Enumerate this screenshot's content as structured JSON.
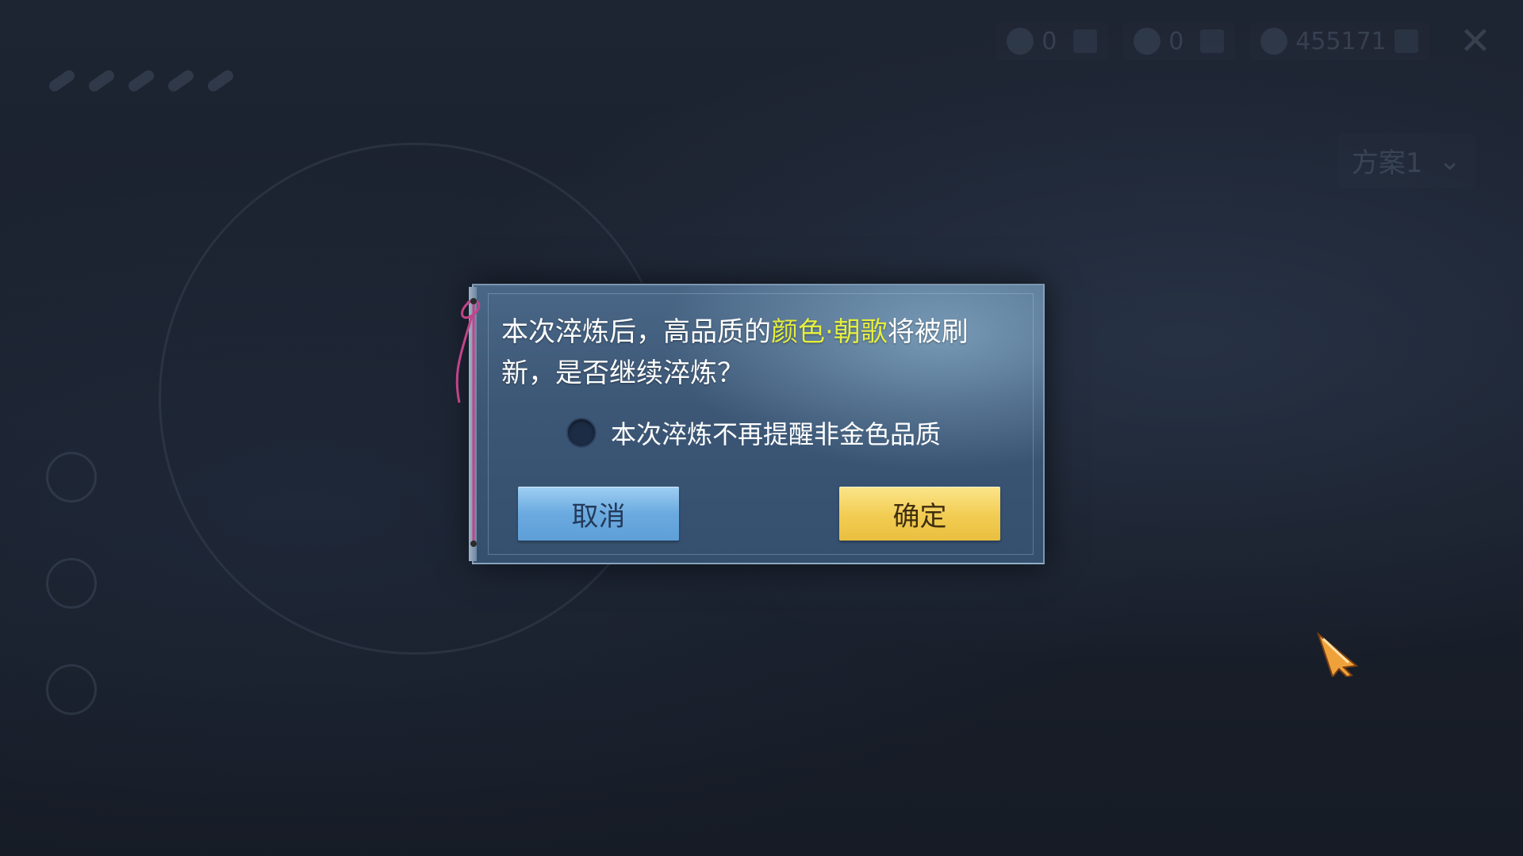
{
  "background": {
    "resources": [
      {
        "icon": "feather-currency-icon",
        "value": "0"
      },
      {
        "icon": "leaf-currency-icon",
        "value": "0"
      },
      {
        "icon": "coin-icon",
        "value": "455171"
      }
    ],
    "quota_label": "",
    "hint_text": "",
    "scheme_label": "方案1"
  },
  "modal": {
    "message_part1": "本次淬炼后，高品质的",
    "message_highlight": "颜色·朝歌",
    "message_part2": "将被刷新，是否继续淬炼？",
    "remind_label": "本次淬炼不再提醒非金色品质",
    "remind_checked": false,
    "cancel_label": "取消",
    "confirm_label": "确定"
  },
  "colors": {
    "highlight": "#e5ee3e",
    "cancel_button": "#6aaae0",
    "confirm_button": "#f2cc52",
    "modal_background": "#3c5675"
  },
  "icons": {
    "close": "close-icon",
    "cursor": "arrow-cursor-icon",
    "dropdown": "chevron-down-icon"
  }
}
